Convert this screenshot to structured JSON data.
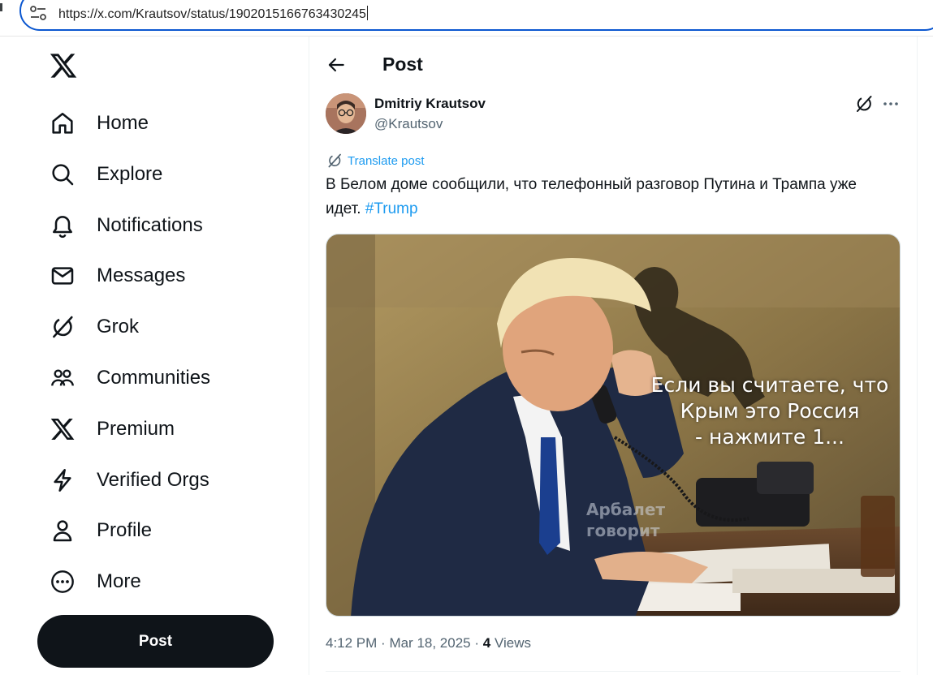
{
  "browser": {
    "url": "https://x.com/Krautsov/status/1902015166763430245"
  },
  "sidebar": {
    "items": [
      {
        "label": "Home",
        "icon": "home-icon"
      },
      {
        "label": "Explore",
        "icon": "search-icon"
      },
      {
        "label": "Notifications",
        "icon": "bell-icon"
      },
      {
        "label": "Messages",
        "icon": "envelope-icon"
      },
      {
        "label": "Grok",
        "icon": "grok-icon"
      },
      {
        "label": "Communities",
        "icon": "people-icon"
      },
      {
        "label": "Premium",
        "icon": "x-logo-icon"
      },
      {
        "label": "Verified Orgs",
        "icon": "lightning-icon"
      },
      {
        "label": "Profile",
        "icon": "person-icon"
      },
      {
        "label": "More",
        "icon": "more-circle-icon"
      }
    ],
    "post_button": "Post"
  },
  "header": {
    "title": "Post"
  },
  "post": {
    "author_name": "Dmitriy Krautsov",
    "author_handle": "@Krautsov",
    "translate_label": "Translate post",
    "text_main": "В Белом доме сообщили, что телефонный разговор Путина и Трампа уже идет. ",
    "hashtag": "#Trump",
    "image_caption_lines": [
      "Если вы считаете, что",
      "Крым это Россия",
      "- нажмите 1..."
    ],
    "watermark_lines": [
      "Арбалет",
      "говорит"
    ],
    "time": "4:12 PM",
    "date": "Mar 18, 2025",
    "views_count": "4",
    "views_label": "Views"
  },
  "colors": {
    "accent": "#1d9bf0",
    "text": "#0f1419",
    "secondary": "#536471",
    "address_border": "#0b57d0"
  }
}
